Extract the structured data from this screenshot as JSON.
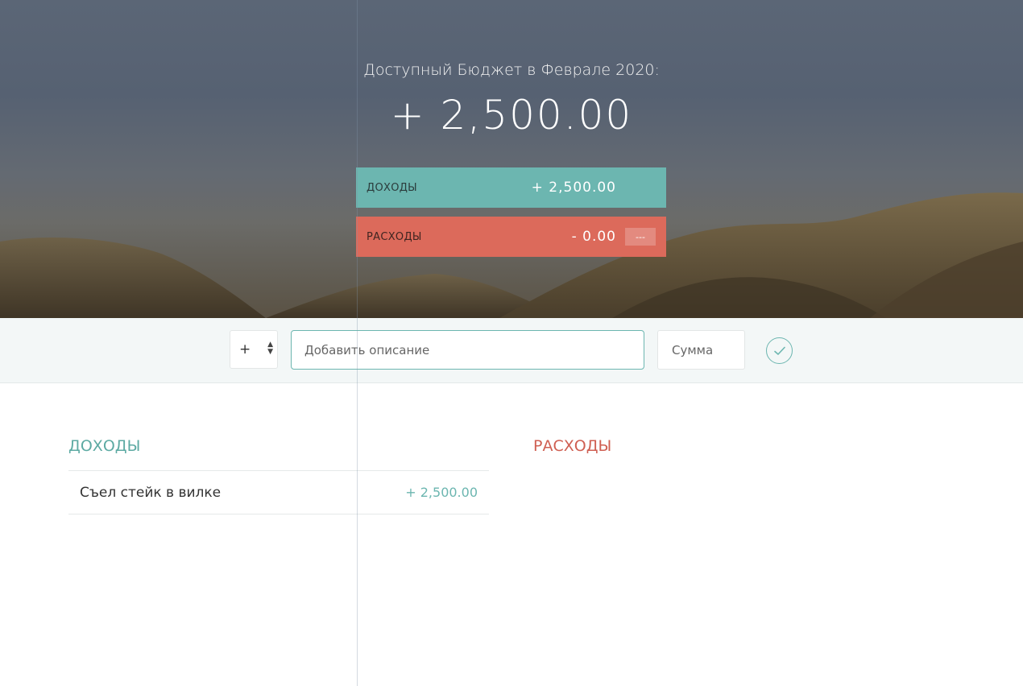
{
  "header": {
    "title": "Доступный Бюджет в Феврале 2020:",
    "total": "+ 2,500.00",
    "income": {
      "label": "Доходы",
      "value": "+ 2,500.00"
    },
    "expenses": {
      "label": "Расходы",
      "value": "- 0.00",
      "percentage": "---"
    }
  },
  "add_form": {
    "type_value": "+",
    "description_placeholder": "Добавить описание",
    "amount_placeholder": "Сумма",
    "confirm_icon": "checkmark-circle-icon"
  },
  "lists": {
    "income_title": "Доходы",
    "expenses_title": "Расходы",
    "income_items": [
      {
        "description": "Съел стейк в вилке",
        "value": "+ 2,500.00"
      }
    ]
  },
  "colors": {
    "income": "#6cb6b0",
    "expenses": "#dc6a5b"
  }
}
